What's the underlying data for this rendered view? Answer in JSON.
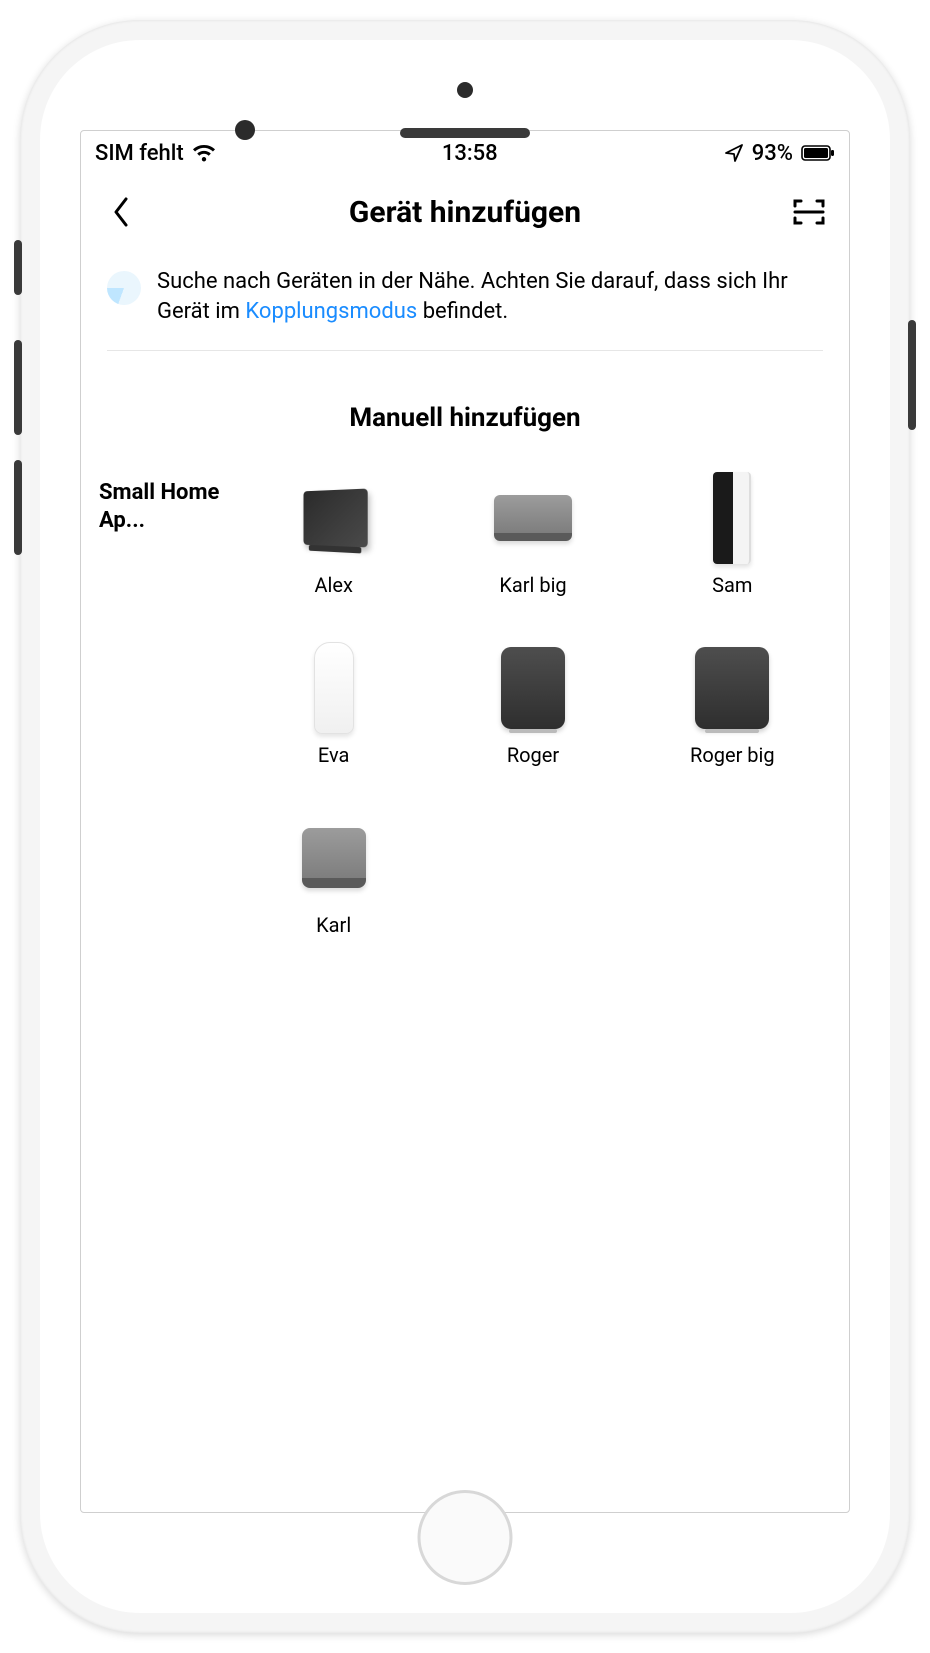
{
  "status": {
    "carrier": "SIM fehlt",
    "time": "13:58",
    "battery_pct": "93%"
  },
  "nav": {
    "title": "Gerät hinzufügen"
  },
  "info": {
    "text_pre": "Suche nach Geräten in der Nähe. Achten Sie darauf, dass sich Ihr Gerät im ",
    "link": "Kopplungsmodus",
    "text_post": " befindet."
  },
  "section": {
    "manual_title": "Manuell hinzufügen"
  },
  "category": {
    "label": "Small Home Ap..."
  },
  "devices": [
    {
      "name": "Alex",
      "shape": "shape-alex"
    },
    {
      "name": "Karl big",
      "shape": "shape-karlbig"
    },
    {
      "name": "Sam",
      "shape": "shape-sam"
    },
    {
      "name": "Eva",
      "shape": "shape-eva"
    },
    {
      "name": "Roger",
      "shape": "shape-roger"
    },
    {
      "name": "Roger big",
      "shape": "shape-rogerbig"
    },
    {
      "name": "Karl",
      "shape": "shape-karl"
    }
  ]
}
